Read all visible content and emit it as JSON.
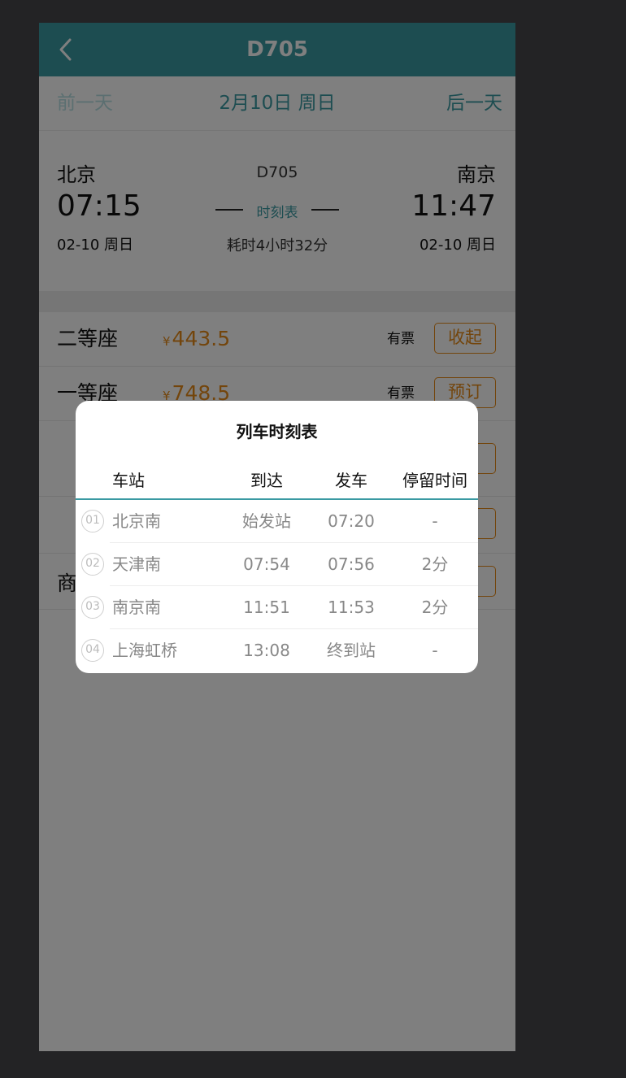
{
  "header": {
    "title": "D705",
    "back_icon": "chevron-left-icon"
  },
  "date_nav": {
    "prev": "前一天",
    "current": "2月10日 周日",
    "next": "后一天"
  },
  "train": {
    "code": "D705",
    "from": {
      "station": "北京",
      "time": "07:15",
      "date": "02-10 周日"
    },
    "to": {
      "station": "南京",
      "time": "11:47",
      "date": "02-10 周日"
    },
    "timetable_link": "时刻表",
    "duration": "耗时4小时32分"
  },
  "seats": [
    {
      "name": "二等座",
      "currency": "¥",
      "price": "443.5",
      "availability": "有票",
      "action": "收起"
    },
    {
      "name": "一等座",
      "currency": "¥",
      "price": "748.5",
      "availability": "有票",
      "action": "预订"
    }
  ],
  "partial_seat_label": "商",
  "modal": {
    "title": "列车时刻表",
    "columns": [
      "车站",
      "到达",
      "发车",
      "停留时间"
    ],
    "rows": [
      {
        "index": "01",
        "station": "北京南",
        "arrive": "始发站",
        "depart": "07:20",
        "stop": "-"
      },
      {
        "index": "02",
        "station": "天津南",
        "arrive": "07:54",
        "depart": "07:56",
        "stop": "2分"
      },
      {
        "index": "03",
        "station": "南京南",
        "arrive": "11:51",
        "depart": "11:53",
        "stop": "2分"
      },
      {
        "index": "04",
        "station": "上海虹桥",
        "arrive": "13:08",
        "depart": "终到站",
        "stop": "-"
      }
    ]
  },
  "colors": {
    "accent": "#3a9aa3",
    "price": "#e78b19",
    "overlay": "rgba(0,0,0,0.5)"
  }
}
